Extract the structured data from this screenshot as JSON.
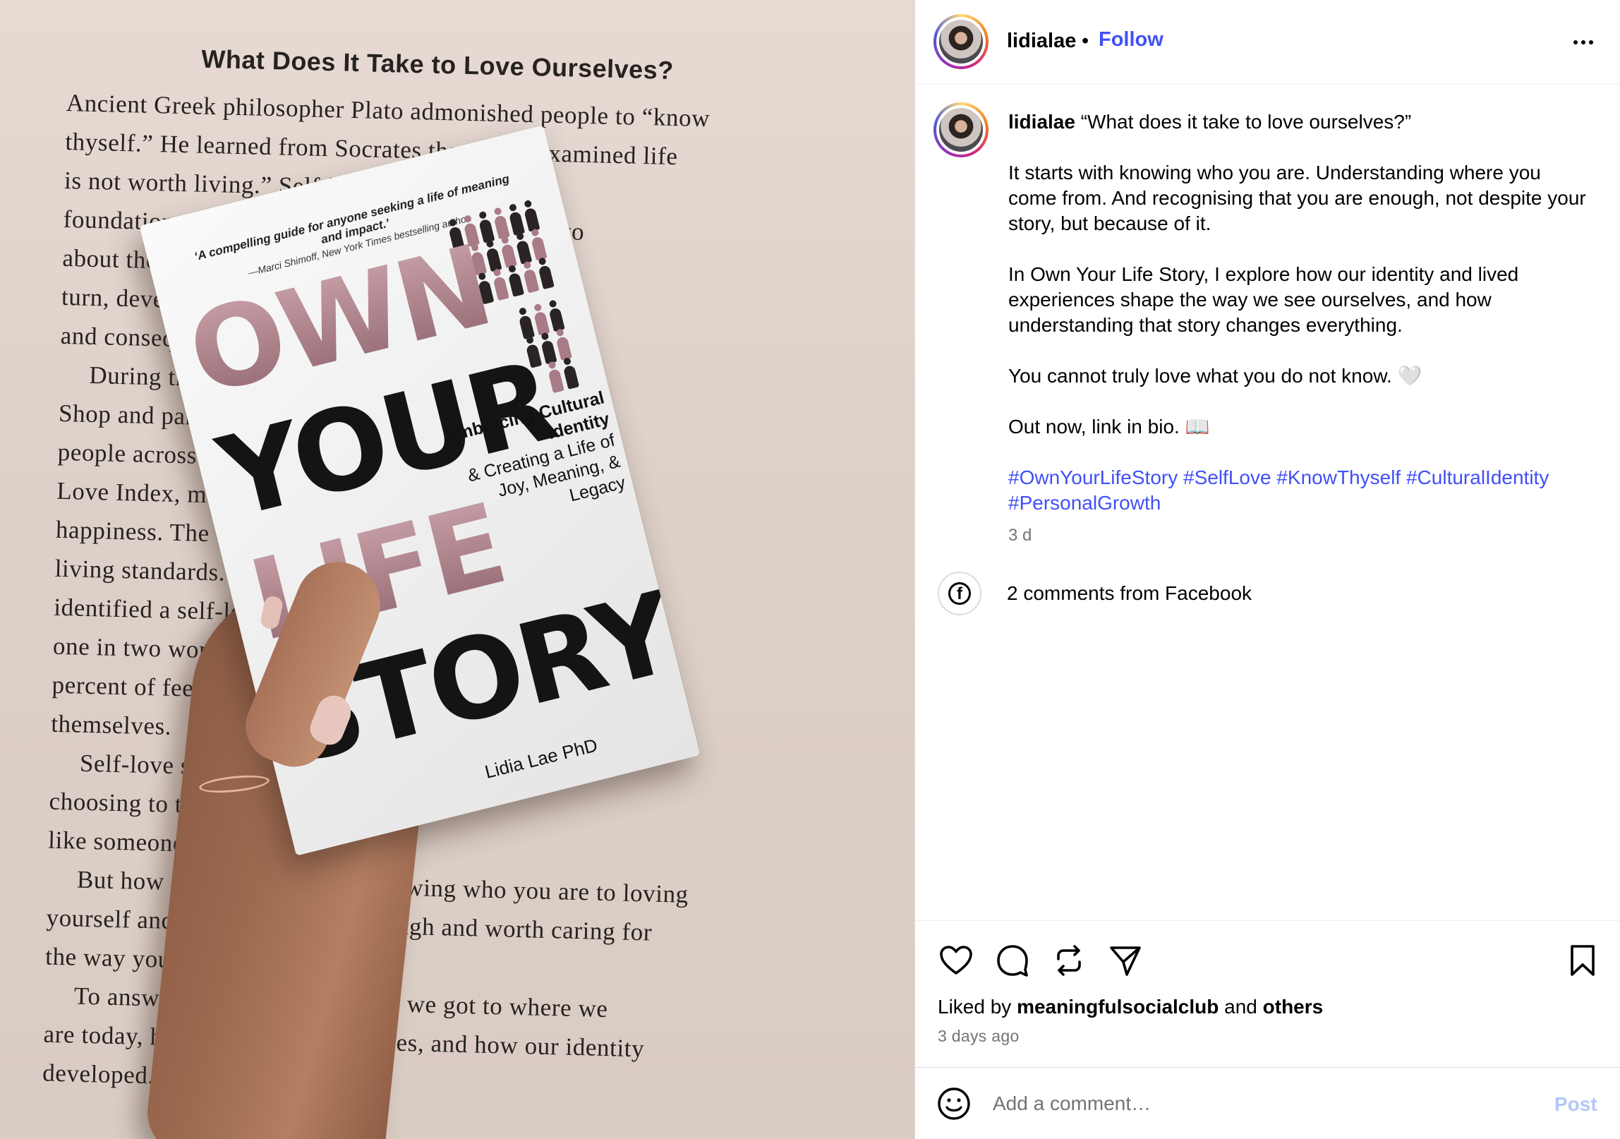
{
  "image": {
    "page_heading": "What Does It Take to Love Ourselves?",
    "page_lines": [
      {
        "text": "Ancient Greek philosopher Plato admonished people to “know",
        "indent": false
      },
      {
        "text": "thyself.” He learned from Socrates that the unexamined life",
        "indent": false
      },
      {
        "text": "is not worth living.” Self-knowledge is the",
        "indent": false
      },
      {
        "text": "foundation of all knowledge. Socrates taught Plato",
        "indent": false
      },
      {
        "text": "about the value of self-knowledge. Plato, in",
        "indent": false
      },
      {
        "text": "turn, developed ideas that is a direct result",
        "indent": false
      },
      {
        "text": "and consequences.",
        "indent": false
      },
      {
        "text": "During the 1990s, retailer The Body",
        "indent": true
      },
      {
        "text": "Shop and partners surveyed two thousand",
        "indent": false
      },
      {
        "text": "people across the Global Self-",
        "indent": false
      },
      {
        "text": "Love Index, measuring well-being, and",
        "indent": false
      },
      {
        "text": "happiness. The country, and",
        "indent": false
      },
      {
        "text": "living standards. Results",
        "indent": false
      },
      {
        "text": "identified a self-love deficit worldwide, with",
        "indent": false
      },
      {
        "text": "one in two women and 60",
        "indent": false
      },
      {
        "text": "percent of feeling respect for",
        "indent": false
      },
      {
        "text": "themselves.",
        "indent": false
      },
      {
        "text": "Self-love starts with respect, by",
        "indent": true
      },
      {
        "text": "choosing to treat yourself",
        "indent": false
      },
      {
        "text": "like someone you love.",
        "indent": false
      },
      {
        "text": "But how do we go from not knowing who you are to loving",
        "indent": true
      },
      {
        "text": "yourself and knowing you are enough and worth caring for",
        "indent": false
      },
      {
        "text": "the way you are?",
        "indent": false
      },
      {
        "text": "To answer this, we explore how we got to where we",
        "indent": true
      },
      {
        "text": "are today, how experiences our lives, and how our identity",
        "indent": false
      },
      {
        "text": "developed.",
        "indent": false
      }
    ],
    "book": {
      "quote": "‘A compelling guide for anyone seeking a life of meaning and impact.’",
      "quote_author": "—Marci Shimoff, New York Times bestselling author",
      "title_words": [
        "OWN",
        "YOUR",
        "LIFE",
        "STORY"
      ],
      "subtitle_bold": "Embracing Cultural Identity",
      "subtitle_rest": "& Creating a Life of Joy, Meaning, & Legacy",
      "author": "Lidia Lae PhD"
    }
  },
  "header": {
    "username": "lidialae",
    "separator": "•",
    "follow_label": "Follow",
    "more_icon": "more-horizontal-icon"
  },
  "caption": {
    "username": "lidialae",
    "first_line": "“What does it take to love ourselves?”",
    "paragraphs": [
      "It starts with knowing who you are. Understanding where you come from. And recognising that you are enough,  not despite your story, but because of it.",
      "In Own Your Life Story, I explore how our identity and lived experiences shape the way we see ourselves, and how understanding that story changes everything.",
      "You cannot truly love what you do not know. 🤍",
      "Out now,  link in bio. 📖"
    ],
    "hashtags": [
      "#OwnYourLifeStory",
      "#SelfLove",
      "#KnowThyself",
      "#CulturalIdentity",
      "#PersonalGrowth"
    ],
    "age": "3 d"
  },
  "facebook_comments": {
    "icon": "facebook-icon",
    "label": "2 comments from Facebook"
  },
  "actions": {
    "icons": [
      "heart-icon",
      "comment-icon",
      "repost-icon",
      "share-icon",
      "bookmark-icon"
    ],
    "likes_prefix": "Liked by",
    "likes_user": "meaningfulsocialclub",
    "likes_conj": "and",
    "likes_others": "others",
    "age": "3 days ago"
  },
  "comment_bar": {
    "emoji_icon": "emoji-icon",
    "placeholder": "Add a comment…",
    "post_label": "Post"
  },
  "colors": {
    "link_blue": "#4150f7",
    "muted_gray": "#737373",
    "post_disabled": "#b3c7f7",
    "divider": "#dbdbdb"
  }
}
